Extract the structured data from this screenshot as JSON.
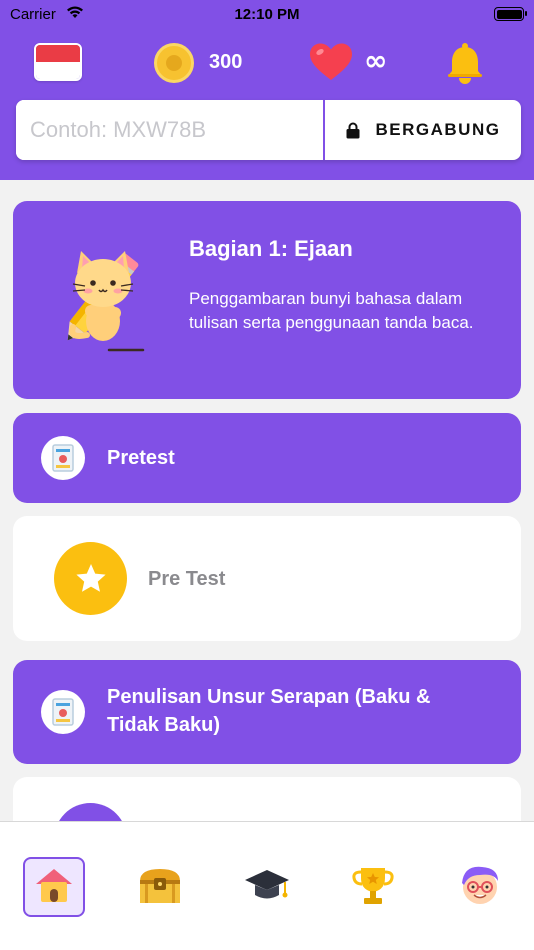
{
  "status_bar": {
    "carrier": "Carrier",
    "time": "12:10 PM"
  },
  "header": {
    "flag_icon": "indonesia-flag-icon",
    "coins": "300",
    "lives": "∞",
    "notification_icon": "bell-icon"
  },
  "join": {
    "placeholder": "Contoh: MXW78B",
    "button_label": "BERGABUNG",
    "button_icon": "lock-icon"
  },
  "section": {
    "title": "Bagian 1: Ejaan",
    "description": "Penggambaran bunyi bahasa dalam tulisan serta penggunaan tanda baca.",
    "mascot_icon": "cat-pencil-mascot"
  },
  "lessons": [
    {
      "title": "Pretest",
      "icon": "quiz-card-icon",
      "items": [
        {
          "label": "Pre Test",
          "icon": "star-icon",
          "color": "#fbbf10"
        }
      ]
    },
    {
      "title": "Penulisan Unsur Serapan (Baku & Tidak Baku)",
      "icon": "quiz-card-icon"
    }
  ],
  "tab_bar": {
    "tabs": [
      {
        "name": "home",
        "icon": "home-icon",
        "active": true
      },
      {
        "name": "chest",
        "icon": "treasure-chest-icon",
        "active": false
      },
      {
        "name": "course",
        "icon": "graduation-cap-icon",
        "active": false
      },
      {
        "name": "leaderboard",
        "icon": "trophy-icon",
        "active": false
      },
      {
        "name": "profile",
        "icon": "avatar-icon",
        "active": false
      }
    ]
  },
  "colors": {
    "primary": "#8150e6",
    "star": "#fbbf10",
    "background": "#f2f2f2"
  }
}
